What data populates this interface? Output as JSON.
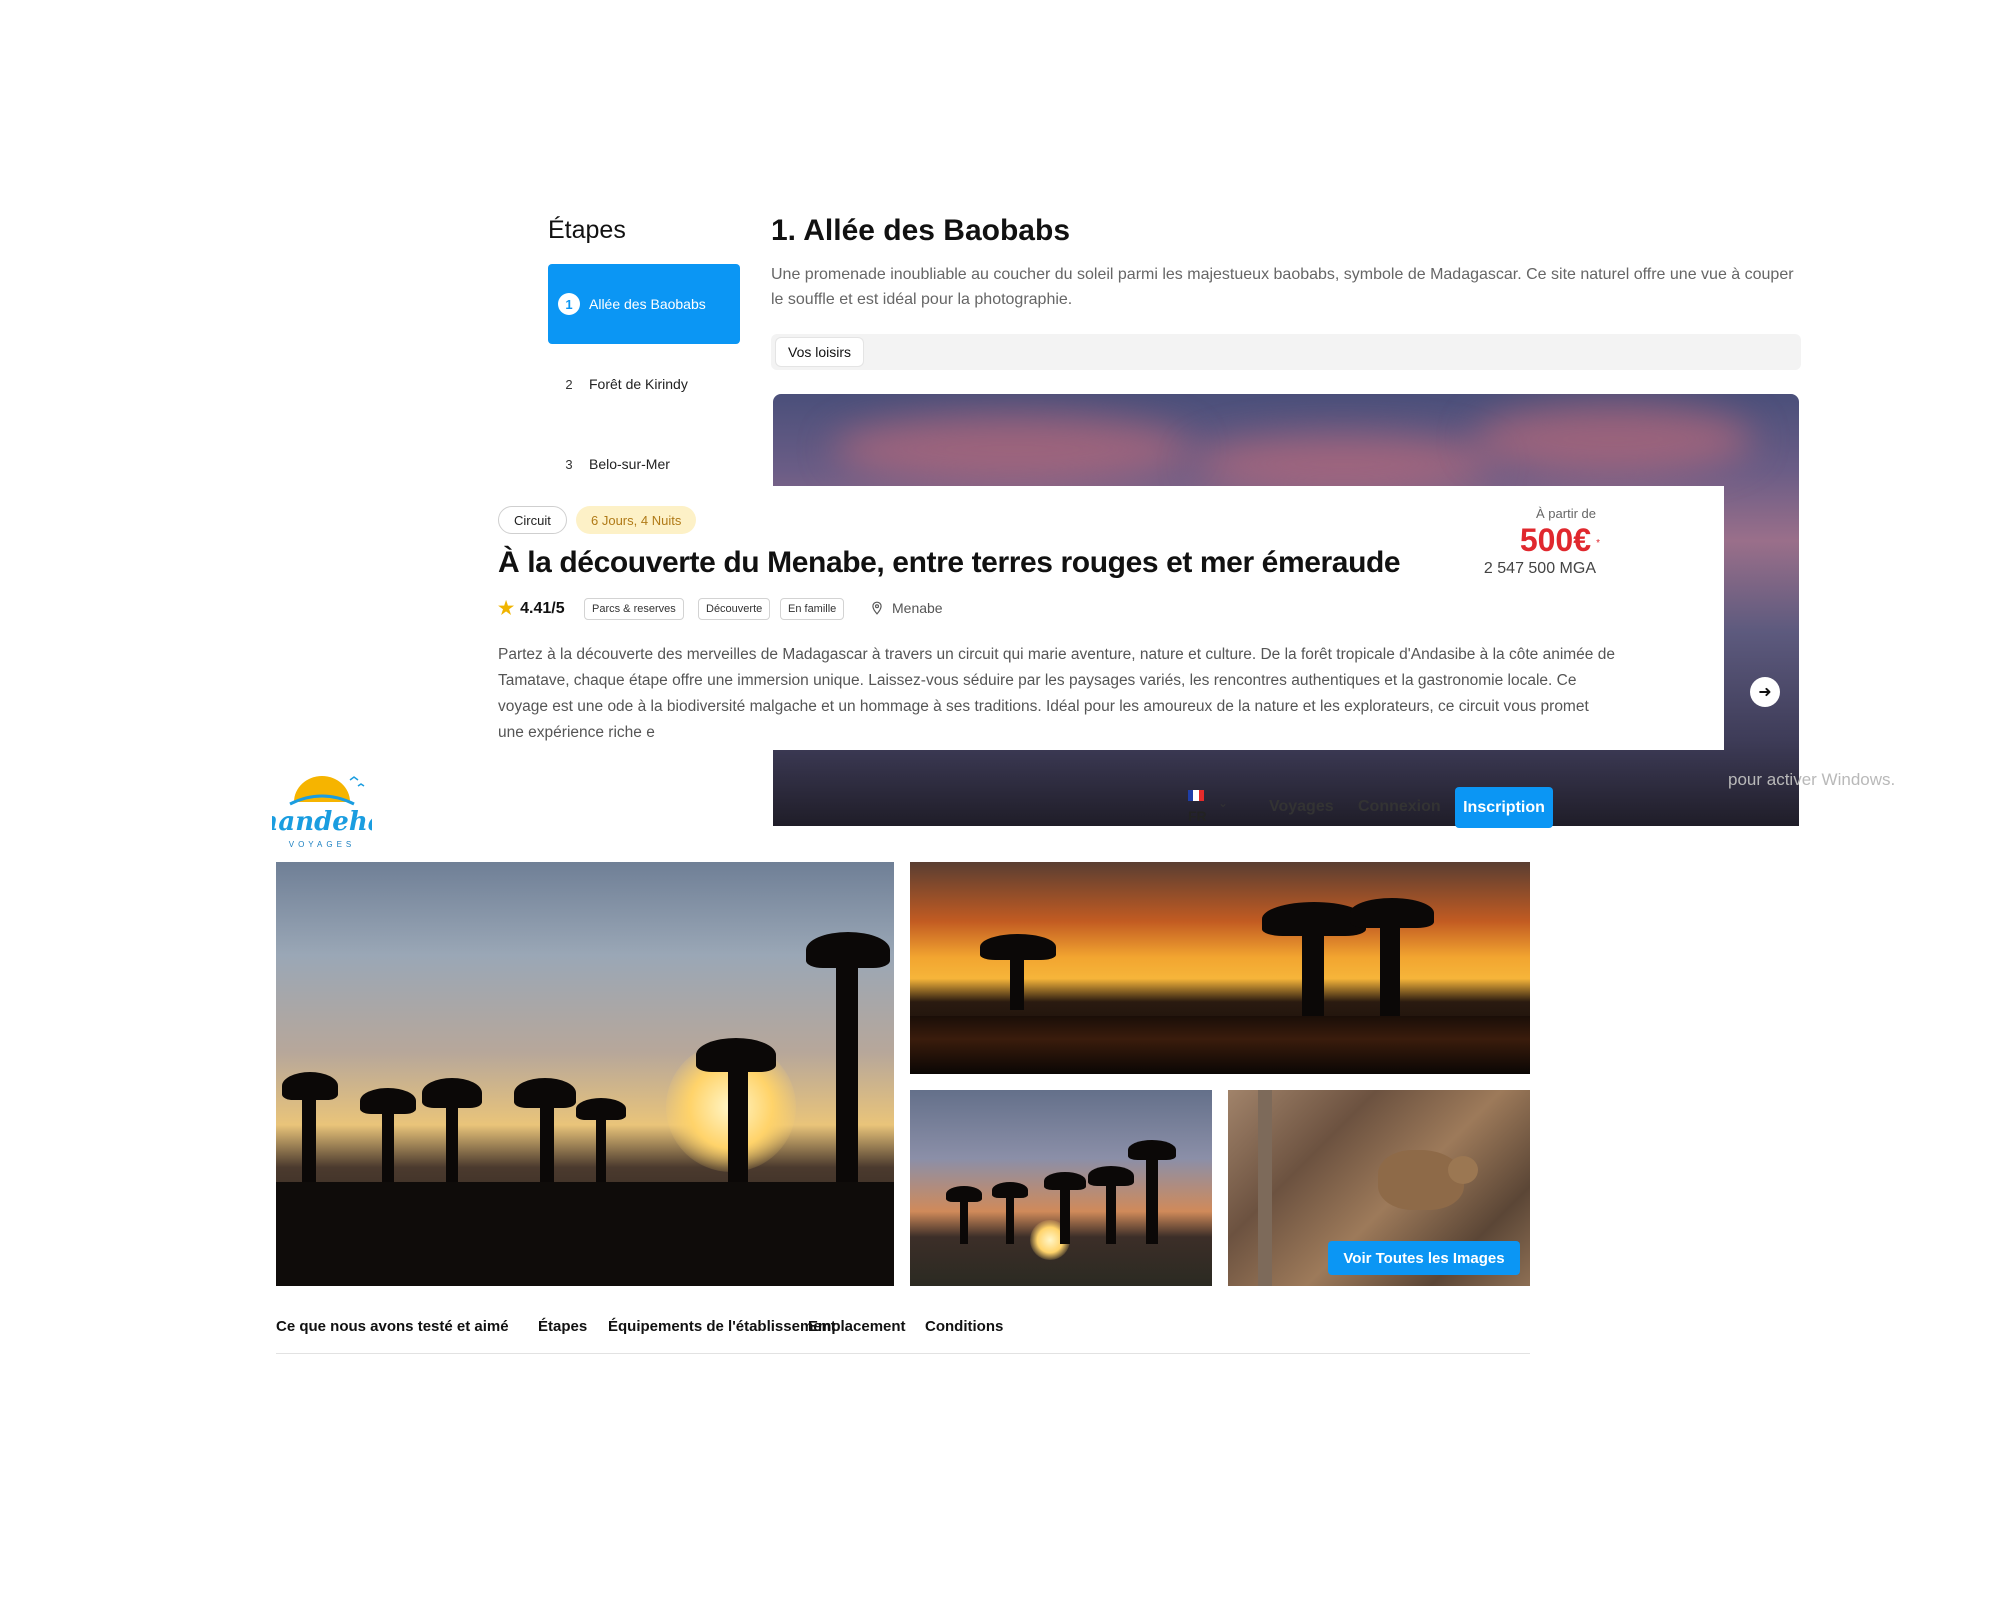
{
  "etapes": {
    "title": "Étapes",
    "steps": [
      {
        "num": "1",
        "label": "Allée des Baobabs",
        "active": true
      },
      {
        "num": "2",
        "label": "Forêt de Kirindy",
        "active": false
      },
      {
        "num": "3",
        "label": "Belo-sur-Mer",
        "active": false
      }
    ],
    "heading": "1. Allée des Baobabs",
    "description": "Une promenade inoubliable au coucher du soleil parmi les majestueux baobabs, symbole de Madagascar. Ce site naturel offre une vue à couper le souffle et est idéal pour la photographie.",
    "leisure_tab": "Vos loisirs",
    "watermark": "pour activer Windows."
  },
  "circuit": {
    "type_badge": "Circuit",
    "duration_badge": "6 Jours, 4 Nuits",
    "title": "À la découverte du Menabe, entre terres rouges et mer émeraude",
    "price_from": "À partir de",
    "price_eur": "500€",
    "price_sup": "*",
    "price_mga": "2 547 500 MGA",
    "rating": "4.41/5",
    "tags": [
      "Parcs & reserves",
      "Découverte",
      "En famille"
    ],
    "location": "Menabe",
    "description": "Partez à la découverte des merveilles de Madagascar à travers un circuit qui marie aventure, nature et culture. De la forêt tropicale d'Andasibe à la côte animée de Tamatave, chaque étape offre une immersion unique. Laissez-vous séduire par les paysages variés, les rencontres authentiques et la gastronomie locale. Ce voyage est une ode à la biodiversité malgache et un hommage à ses traditions. Idéal pour les amoureux de la nature et les explorateurs, ce circuit vous promet une expérience riche e"
  },
  "header": {
    "logo_text": "handeha",
    "logo_sub": "VOYAGES",
    "lang": "FR",
    "nav": [
      "Voyages",
      "Connexion"
    ],
    "signup": "Inscription"
  },
  "gallery": {
    "see_all": "Voir Toutes les Images"
  },
  "section_tabs": [
    "Ce que nous avons testé et aimé",
    "Étapes",
    "Équipements de l'établissement",
    "Emplacement",
    "Conditions"
  ],
  "colors": {
    "accent": "#0b96f4",
    "price": "#e0282e",
    "duration_bg": "#fdf1c7"
  },
  "icons": {
    "star": "star-icon",
    "pin": "map-pin-icon",
    "arrow": "arrow-right-icon",
    "chevron": "chevron-down-icon"
  }
}
